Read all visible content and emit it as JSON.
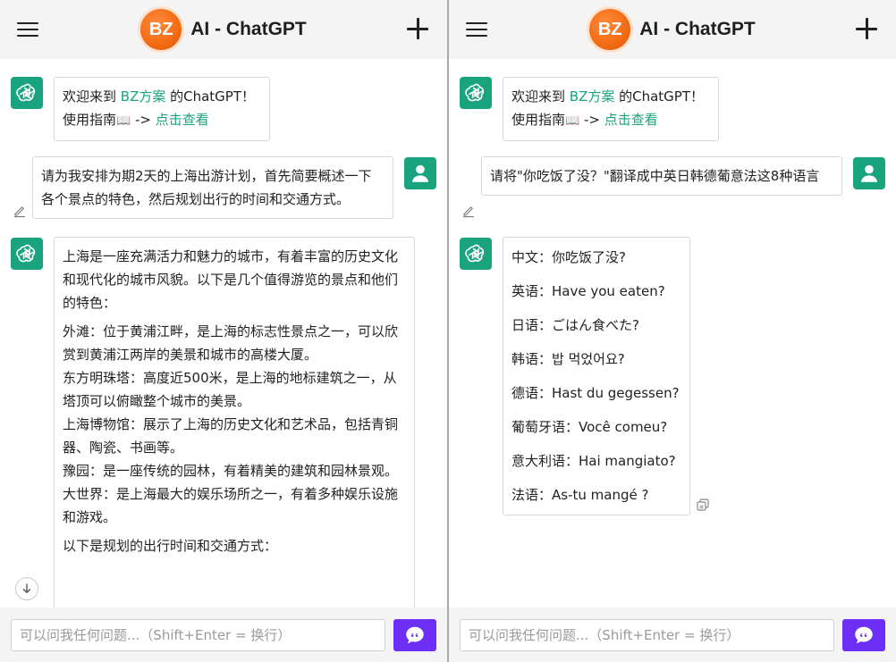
{
  "app": {
    "title": "AI - ChatGPT",
    "logo_text": "BZ"
  },
  "colors": {
    "accent": "#19a37f",
    "send": "#6d2ef5",
    "logo": "#f26b12",
    "header_bg": "#f4f4f4"
  },
  "icons": {
    "menu": "menu-icon",
    "new_chat": "plus-icon",
    "ai_avatar": "chatgpt-logo-icon",
    "user_avatar": "user-icon",
    "edit": "pencil-icon",
    "send": "chat-bubble-icon",
    "copy": "copy-icon",
    "scroll": "arrow-down-icon"
  },
  "welcome": {
    "prefix": "欢迎来到 ",
    "link": "BZ方案",
    "suffix": " 的ChatGPT！",
    "guide_label": "使用指南",
    "guide_arrow": " -> ",
    "guide_link": "点击查看"
  },
  "left": {
    "user_message": "请为我安排为期2天的上海出游计划，首先简要概述一下各个景点的特色，然后规划出行的时间和交通方式。",
    "reply": {
      "intro": "上海是一座充满活力和魅力的城市，有着丰富的历史文化和现代化的城市风貌。以下是几个值得游览的景点和他们的特色：",
      "spots": [
        "外滩：位于黄浦江畔，是上海的标志性景点之一，可以欣赏到黄浦江两岸的美景和城市的高楼大厦。",
        "东方明珠塔：高度近500米，是上海的地标建筑之一，从塔顶可以俯瞰整个城市的美景。",
        "上海博物馆：展示了上海的历史文化和艺术品，包括青铜器、陶瓷、书画等。",
        "豫园：是一座传统的园林，有着精美的建筑和园林景观。",
        "大世界：是上海最大的娱乐场所之一，有着多种娱乐设施和游戏。"
      ],
      "outro": "以下是规划的出行时间和交通方式："
    }
  },
  "right": {
    "user_message": "请将\"你吃饭了没？\"翻译成中英日韩德葡意法这8种语言",
    "translations": [
      "中文：你吃饭了没?",
      "英语：Have you eaten?",
      "日语：ごはん食べた?",
      "韩语：밥 먹었어요?",
      "德语：Hast du gegessen?",
      "葡萄牙语：Você comeu?",
      "意大利语：Hai mangiato?",
      "法语：As-tu mangé ?"
    ]
  },
  "input": {
    "placeholder": "可以问我任何问题...（Shift+Enter = 换行）"
  }
}
